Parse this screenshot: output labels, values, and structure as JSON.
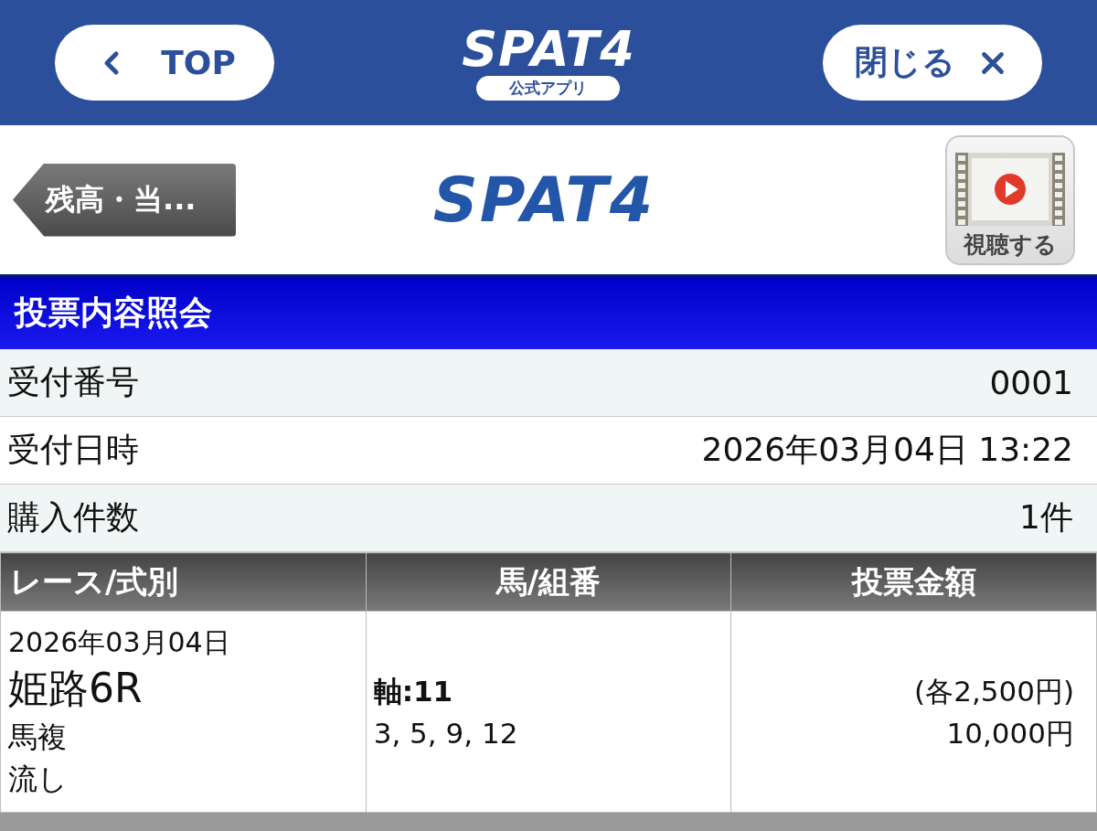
{
  "app_header": {
    "back_button": {
      "label": "TOP"
    },
    "logo": {
      "text": "SPAT4",
      "tagline": "公式アプリ"
    },
    "close_button": {
      "label": "閉じる"
    }
  },
  "page_header": {
    "back_button": {
      "label": "残高・当..."
    },
    "logo": "SPAT4",
    "video_button": {
      "label": "視聴する"
    }
  },
  "section_title": "投票内容照会",
  "summary": [
    {
      "label": "受付番号",
      "value": "0001"
    },
    {
      "label": "受付日時",
      "value": "2026年03月04日 13:22"
    },
    {
      "label": "購入件数",
      "value": "1件"
    }
  ],
  "table": {
    "columns": [
      "レース/式別",
      "馬/組番",
      "投票金額"
    ],
    "rows": [
      {
        "race_date": "2026年03月04日",
        "race": "姫路6R",
        "bet_type": "馬複",
        "method": "流し",
        "axis": "軸:11",
        "partners": "3, 5, 9, 12",
        "unit_amount": "(各2,500円)",
        "total": "10,000円"
      }
    ]
  }
}
